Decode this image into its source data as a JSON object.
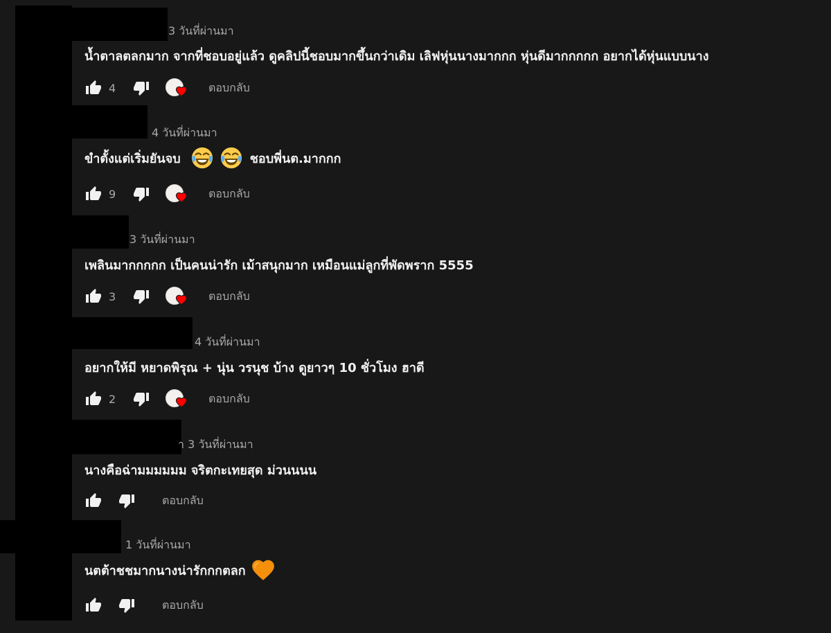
{
  "colors": {
    "background": "#181818",
    "text": "#f1f1f1",
    "secondary": "#aaaaaa",
    "heart": "#ff0000",
    "redaction": "#000000"
  },
  "comments": [
    {
      "time": "3 วันที่ผ่านมา",
      "text": "น้ำตาลตลกมาก จากที่ชอบอยู่แล้ว ดูคลิปนี้ชอบมากขึ้นกว่าเดิม เลิฟหุ่นนางมากกก หุ่นดีมากกกกก อยากได้หุ่นแบบนาง",
      "likes": "4",
      "reply": "ตอบกลับ"
    },
    {
      "time": "4 วันที่ผ่านมา",
      "text": "ขำตั้งแต่เริ่มยันจบ",
      "emoji_1": "laughing-tears-emoji",
      "emoji_2": "laughing-tears-emoji",
      "text_after": "ชอบพี่นต.มากกก",
      "likes": "9",
      "reply": "ตอบกลับ"
    },
    {
      "time": "3 วันที่ผ่านมา",
      "text": "เพลินมากกกกก เป็นคนน่ารัก เม้าสนุกมาก เหมือนแม่ลูกที่พัดพราก 5555",
      "likes": "3",
      "reply": "ตอบกลับ"
    },
    {
      "time": "4 วันที่ผ่านมา",
      "text": "อยากให้มี หยาดพิรุณ + นุ่น วรนุช บ้าง ดูยาวๆ 10 ชั่วโมง ฮาดี",
      "likes": "2",
      "reply": "ตอบกลับ"
    },
    {
      "time_prefix": "า",
      "time": "3 วันที่ผ่านมา",
      "text": "นางคือฉ่ามมมมมม จริตกะเทยสุด ม่วนนนน",
      "reply": "ตอบกลับ"
    },
    {
      "time": "1 วันที่ผ่านมา",
      "text": "นตต้าชชมากนางน่ารักกกตลก",
      "emoji_1": "orange-heart-emoji",
      "reply": "ตอบกลับ"
    }
  ]
}
